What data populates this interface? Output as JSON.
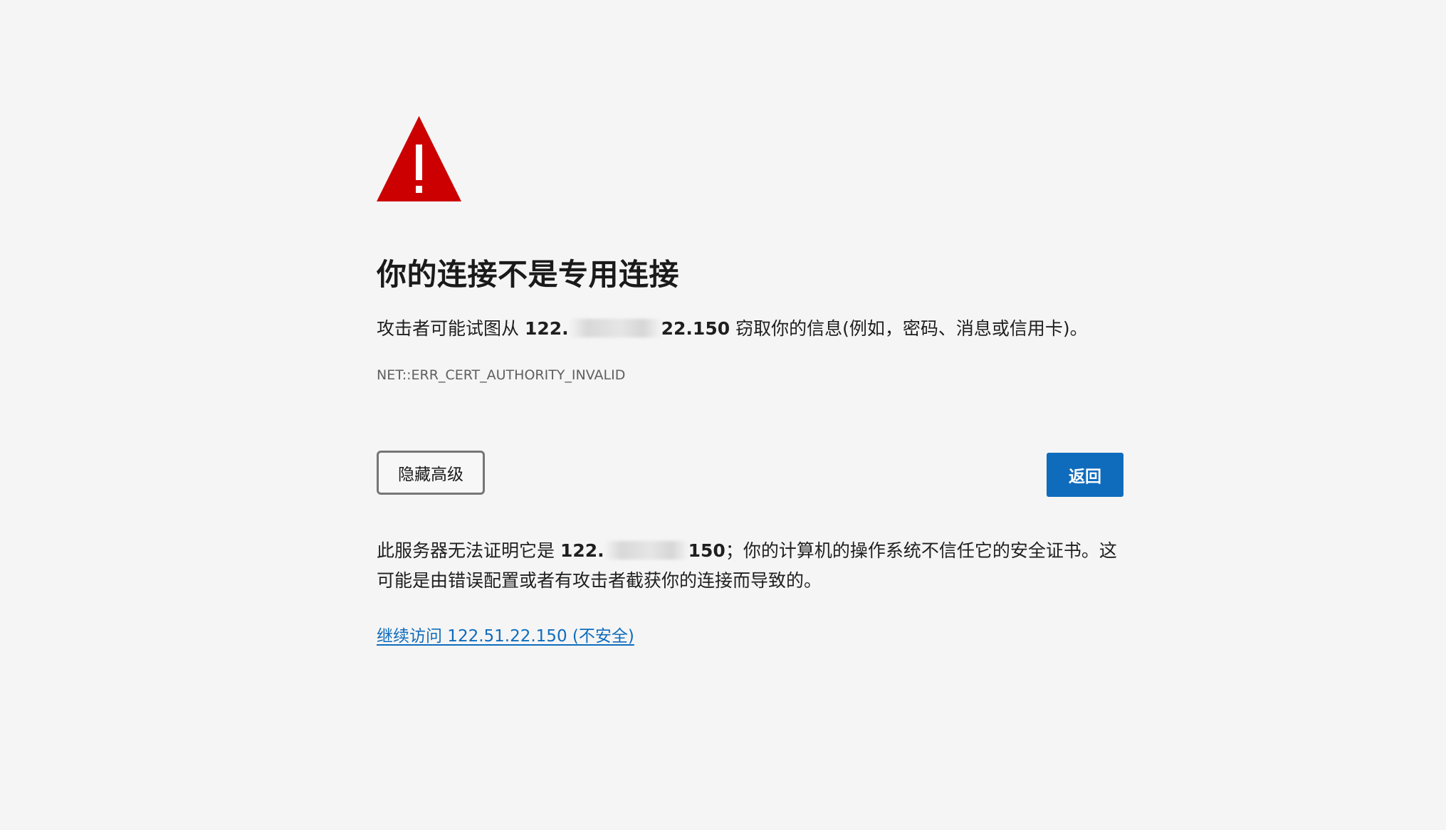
{
  "icon": "warning-triangle-icon",
  "colors": {
    "warning_red": "#cc0000",
    "primary_blue": "#0f6cbd",
    "background": "#f5f5f5"
  },
  "title": "你的连接不是专用连接",
  "description": {
    "prefix": "攻击者可能试图从 ",
    "host_start": "122.",
    "host_end": "22.150",
    "suffix": " 窃取你的信息(例如，密码、消息或信用卡)。"
  },
  "error_code": "NET::ERR_CERT_AUTHORITY_INVALID",
  "buttons": {
    "advanced": "隐藏高级",
    "back": "返回"
  },
  "detail": {
    "prefix": "此服务器无法证明它是 ",
    "host_start": "122.",
    "host_end": "150",
    "suffix": "；你的计算机的操作系统不信任它的安全证书。这可能是由错误配置或者有攻击者截获你的连接而导致的。"
  },
  "proceed_link": "继续访问 122.51.22.150 (不安全)"
}
